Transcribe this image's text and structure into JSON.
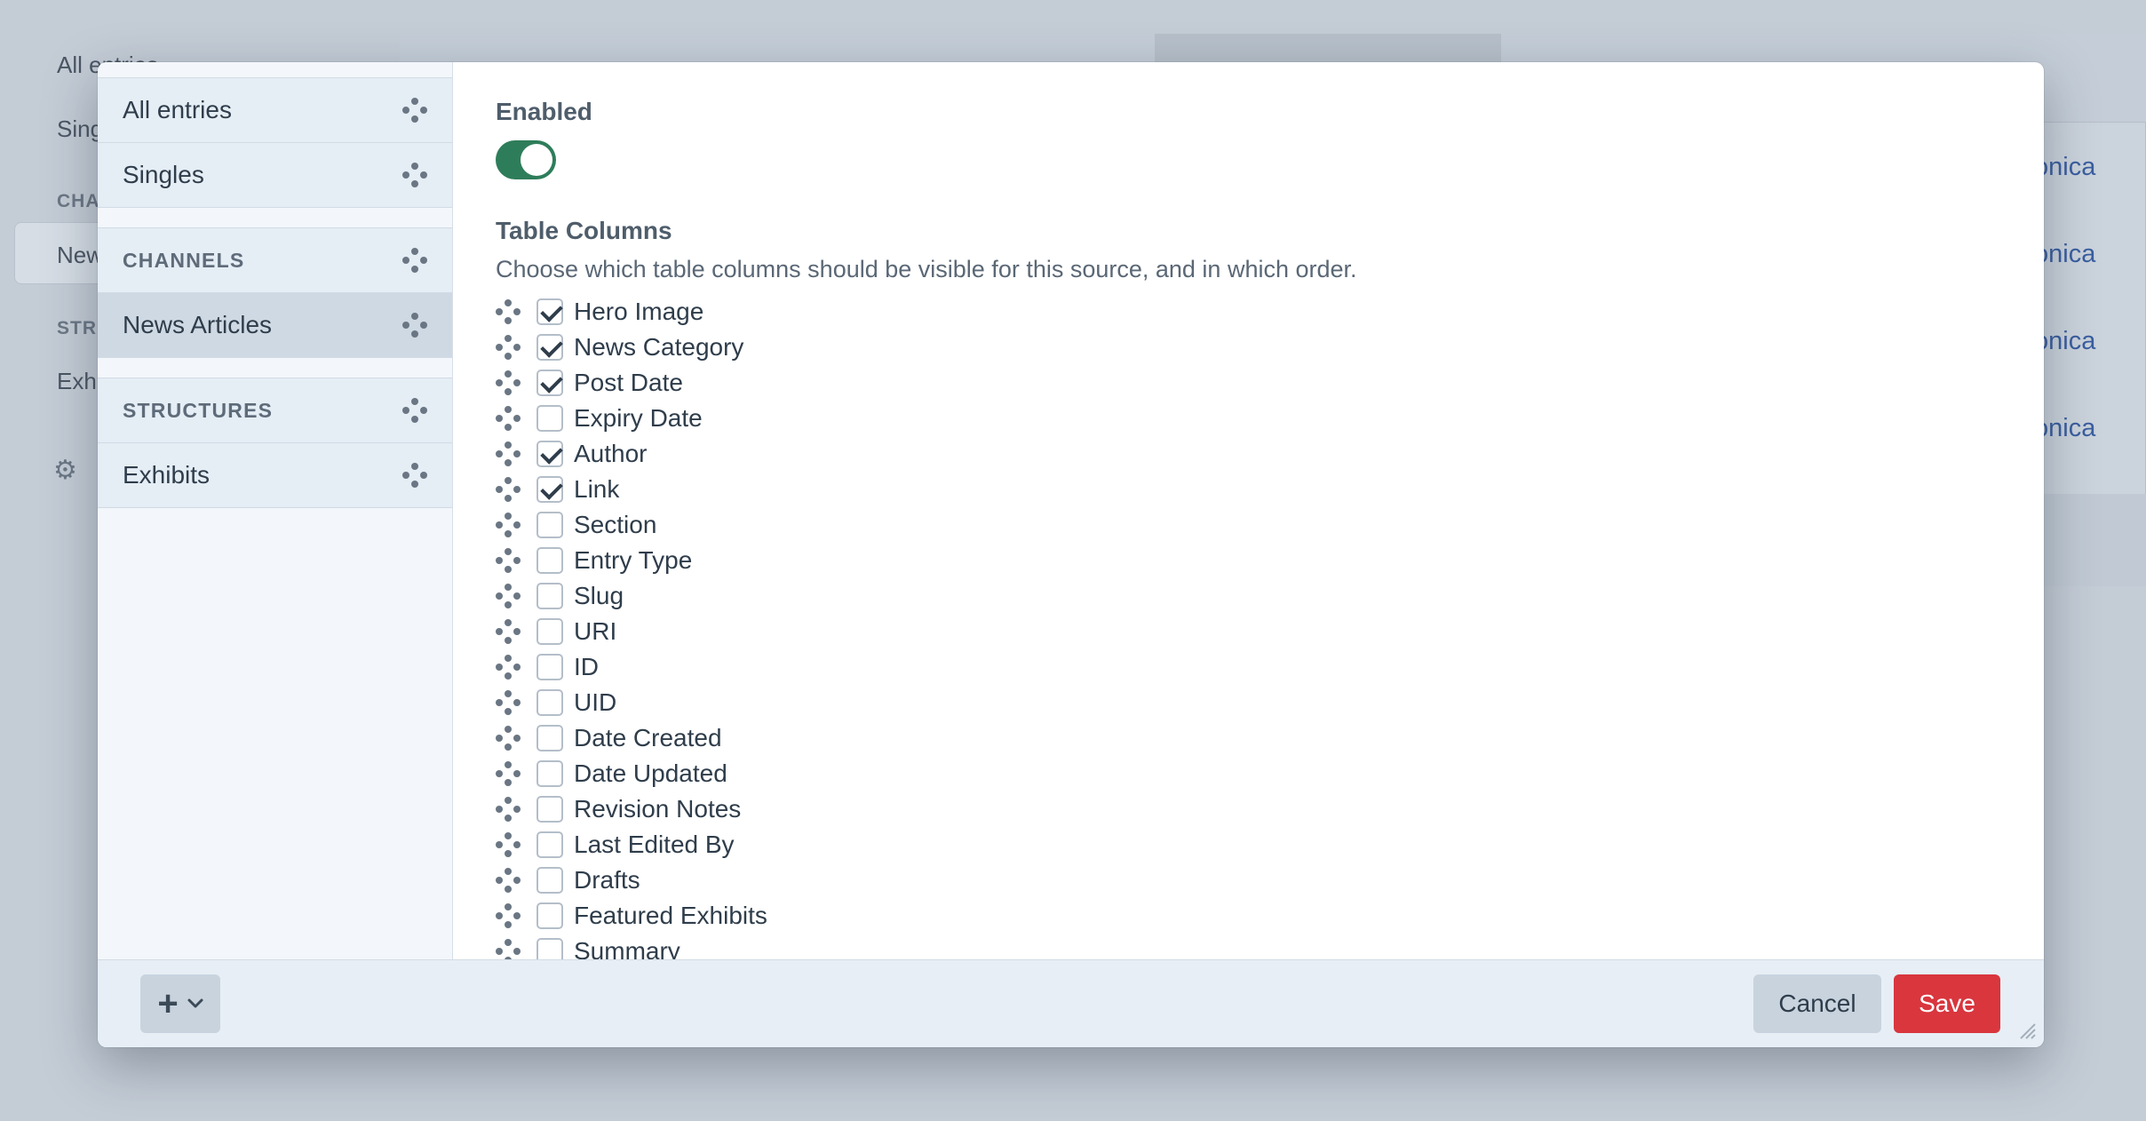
{
  "background": {
    "sidebar_items": [
      "All entries",
      "Singles",
      "CHA",
      "New",
      "STR",
      "Exhi"
    ],
    "link_text": "onica"
  },
  "modal": {
    "sources": [
      {
        "type": "item",
        "label": "All entries"
      },
      {
        "type": "item",
        "label": "Singles"
      },
      {
        "type": "heading",
        "label": "CHANNELS"
      },
      {
        "type": "item",
        "label": "News Articles",
        "selected": true
      },
      {
        "type": "heading",
        "label": "STRUCTURES"
      },
      {
        "type": "item",
        "label": "Exhibits"
      }
    ],
    "enabled_label": "Enabled",
    "enabled": true,
    "table_columns_label": "Table Columns",
    "table_columns_instructions": "Choose which table columns should be visible for this source, and in which order.",
    "columns": [
      {
        "name": "Hero Image",
        "checked": true
      },
      {
        "name": "News Category",
        "checked": true
      },
      {
        "name": "Post Date",
        "checked": true
      },
      {
        "name": "Expiry Date",
        "checked": false
      },
      {
        "name": "Author",
        "checked": true
      },
      {
        "name": "Link",
        "checked": true
      },
      {
        "name": "Section",
        "checked": false
      },
      {
        "name": "Entry Type",
        "checked": false
      },
      {
        "name": "Slug",
        "checked": false
      },
      {
        "name": "URI",
        "checked": false
      },
      {
        "name": "ID",
        "checked": false
      },
      {
        "name": "UID",
        "checked": false
      },
      {
        "name": "Date Created",
        "checked": false
      },
      {
        "name": "Date Updated",
        "checked": false
      },
      {
        "name": "Revision Notes",
        "checked": false
      },
      {
        "name": "Last Edited By",
        "checked": false
      },
      {
        "name": "Drafts",
        "checked": false
      },
      {
        "name": "Featured Exhibits",
        "checked": false
      },
      {
        "name": "Summary",
        "checked": false
      }
    ],
    "footer": {
      "add_icon": "+",
      "cancel_label": "Cancel",
      "save_label": "Save"
    }
  },
  "colors": {
    "toggle_on": "#2e7d5a",
    "save": "#d9363e",
    "link": "#3a5ea0"
  }
}
